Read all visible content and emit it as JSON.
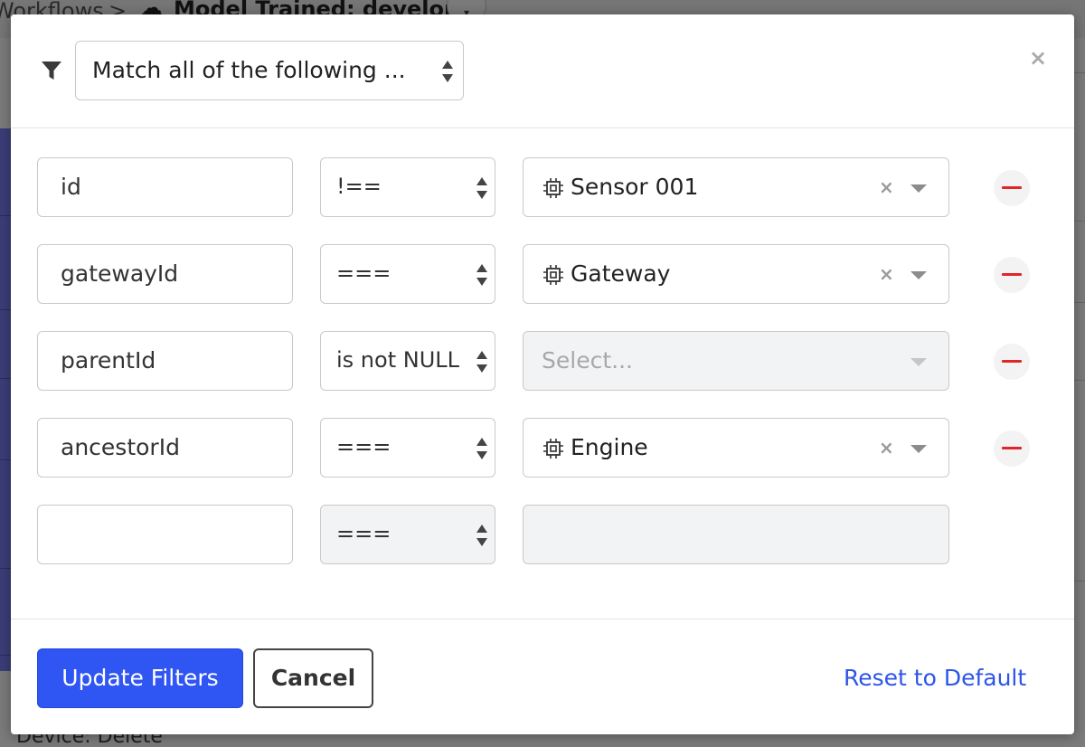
{
  "background": {
    "breadcrumb": "Workflows",
    "breadcrumb_separator": ">",
    "page_title": "Model Trained: develop",
    "bottom_left_text": "Device: Delete"
  },
  "modal": {
    "match_mode": {
      "value": "Match all of the following ...",
      "icon": "filter-icon"
    },
    "close_label": "×",
    "rows": [
      {
        "field": "id",
        "operator": "!==",
        "value": "Sensor 001",
        "value_icon": "chip-icon",
        "clear": "×"
      },
      {
        "field": "gatewayId",
        "operator": "===",
        "value": "Gateway",
        "value_icon": "chip-icon",
        "clear": "×"
      },
      {
        "field": "parentId",
        "operator": "is not NULL",
        "value_placeholder": "Select..."
      },
      {
        "field": "ancestorId",
        "operator": "===",
        "value": "Engine",
        "value_icon": "chip-icon",
        "clear": "×"
      },
      {
        "field": "",
        "operator": "===",
        "value": ""
      }
    ],
    "footer": {
      "update_label": "Update Filters",
      "cancel_label": "Cancel",
      "reset_label": "Reset to Default"
    }
  },
  "colors": {
    "primary": "#2f55f2",
    "link": "#2d55e8",
    "remove": "#e0262a",
    "border": "#c9c9c9"
  }
}
